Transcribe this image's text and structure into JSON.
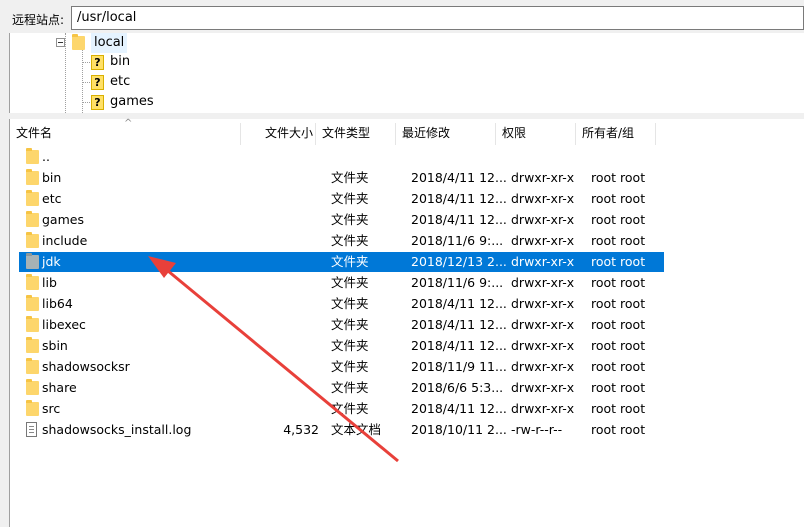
{
  "remote_site": {
    "label": "远程站点:",
    "path": "/usr/local"
  },
  "tree": {
    "current": "local",
    "children": [
      "bin",
      "etc",
      "games"
    ]
  },
  "columns": {
    "name": "文件名",
    "size": "文件大小",
    "type": "文件类型",
    "modified": "最近修改",
    "perms": "权限",
    "owner": "所有者/组"
  },
  "files": [
    {
      "name": "..",
      "size": "",
      "type": "",
      "modified": "",
      "perms": "",
      "owner": "",
      "icon": "folder-icon"
    },
    {
      "name": "bin",
      "size": "",
      "type": "文件夹",
      "modified": "2018/4/11 12...",
      "perms": "drwxr-xr-x",
      "owner": "root root",
      "icon": "folder-icon"
    },
    {
      "name": "etc",
      "size": "",
      "type": "文件夹",
      "modified": "2018/4/11 12...",
      "perms": "drwxr-xr-x",
      "owner": "root root",
      "icon": "folder-icon"
    },
    {
      "name": "games",
      "size": "",
      "type": "文件夹",
      "modified": "2018/4/11 12...",
      "perms": "drwxr-xr-x",
      "owner": "root root",
      "icon": "folder-icon"
    },
    {
      "name": "include",
      "size": "",
      "type": "文件夹",
      "modified": "2018/11/6 9:...",
      "perms": "drwxr-xr-x",
      "owner": "root root",
      "icon": "folder-icon"
    },
    {
      "name": "jdk",
      "size": "",
      "type": "文件夹",
      "modified": "2018/12/13 2...",
      "perms": "drwxr-xr-x",
      "owner": "root root",
      "icon": "folder-icon",
      "selected": true
    },
    {
      "name": "lib",
      "size": "",
      "type": "文件夹",
      "modified": "2018/11/6 9:...",
      "perms": "drwxr-xr-x",
      "owner": "root root",
      "icon": "folder-icon"
    },
    {
      "name": "lib64",
      "size": "",
      "type": "文件夹",
      "modified": "2018/4/11 12...",
      "perms": "drwxr-xr-x",
      "owner": "root root",
      "icon": "folder-icon"
    },
    {
      "name": "libexec",
      "size": "",
      "type": "文件夹",
      "modified": "2018/4/11 12...",
      "perms": "drwxr-xr-x",
      "owner": "root root",
      "icon": "folder-icon"
    },
    {
      "name": "sbin",
      "size": "",
      "type": "文件夹",
      "modified": "2018/4/11 12...",
      "perms": "drwxr-xr-x",
      "owner": "root root",
      "icon": "folder-icon"
    },
    {
      "name": "shadowsocksr",
      "size": "",
      "type": "文件夹",
      "modified": "2018/11/9 11...",
      "perms": "drwxr-xr-x",
      "owner": "root root",
      "icon": "folder-icon"
    },
    {
      "name": "share",
      "size": "",
      "type": "文件夹",
      "modified": "2018/6/6 5:3...",
      "perms": "drwxr-xr-x",
      "owner": "root root",
      "icon": "folder-icon"
    },
    {
      "name": "src",
      "size": "",
      "type": "文件夹",
      "modified": "2018/4/11 12...",
      "perms": "drwxr-xr-x",
      "owner": "root root",
      "icon": "folder-icon"
    },
    {
      "name": "shadowsocks_install.log",
      "size": "4,532",
      "type": "文本文档",
      "modified": "2018/10/11 2...",
      "perms": "-rw-r--r--",
      "owner": "root root",
      "icon": "text-file-icon"
    }
  ],
  "colors": {
    "selection": "#0078d7",
    "annotation_arrow": "#e8403a"
  }
}
